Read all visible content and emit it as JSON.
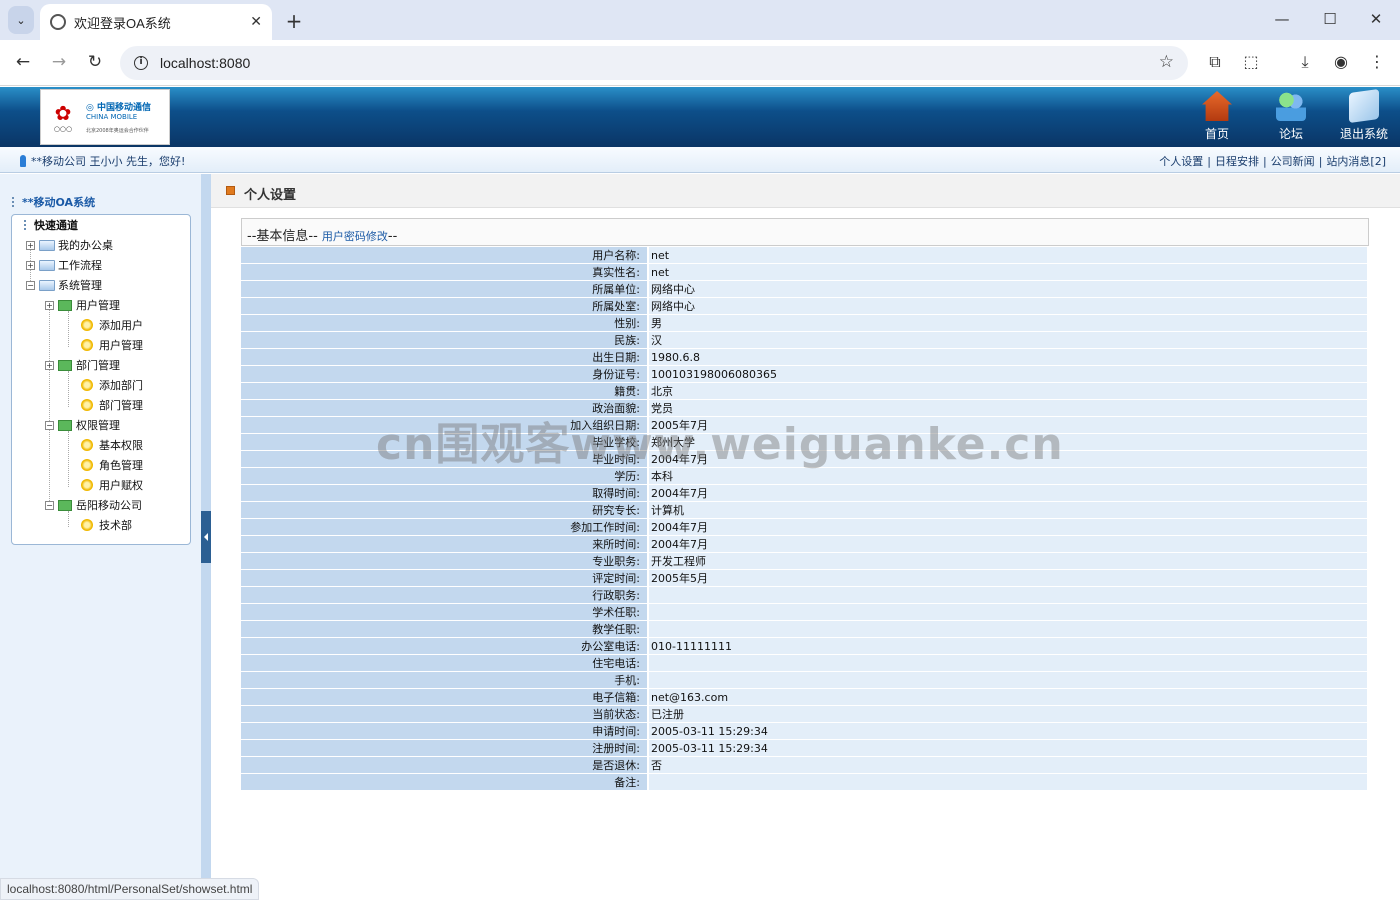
{
  "browser": {
    "tab_title": "欢迎登录OA系统",
    "tab_close": "✕",
    "new_tab": "+",
    "url": "localhost:8080",
    "status_url": "localhost:8080/html/PersonalSet/showset.html"
  },
  "header": {
    "nav": [
      {
        "label": "首页",
        "icon": "home-icon"
      },
      {
        "label": "论坛",
        "icon": "forum-icon"
      },
      {
        "label": "退出系统",
        "icon": "exit-icon"
      }
    ]
  },
  "userbar": {
    "greeting": "**移动公司 王小小 先生，您好!",
    "links": [
      "个人设置",
      "日程安排",
      "公司新闻",
      "站内消息[2]"
    ]
  },
  "sidebar": {
    "title": "**移动OA系统",
    "quick": "快速通道",
    "tree": {
      "l1": [
        "我的办公桌",
        "工作流程",
        "系统管理"
      ],
      "user_mgmt": "用户管理",
      "user_children": [
        "添加用户",
        "用户管理"
      ],
      "dept_mgmt": "部门管理",
      "dept_children": [
        "添加部门",
        "部门管理"
      ],
      "perm_mgmt": "权限管理",
      "perm_children": [
        "基本权限",
        "角色管理",
        "用户赋权"
      ],
      "company": "岳阳移动公司",
      "company_children": [
        "技术部"
      ]
    }
  },
  "main": {
    "title": "个人设置",
    "section_prefix": "--基本信息--",
    "section_link": "用户密码修改",
    "section_suffix": "--",
    "fields": [
      {
        "label": "用户名称:",
        "value": "net"
      },
      {
        "label": "真实性名:",
        "value": "net"
      },
      {
        "label": "所属单位:",
        "value": "网络中心"
      },
      {
        "label": "所属处室:",
        "value": "网络中心"
      },
      {
        "label": "性别:",
        "value": "男"
      },
      {
        "label": "民族:",
        "value": "汉"
      },
      {
        "label": "出生日期:",
        "value": "1980.6.8"
      },
      {
        "label": "身份证号:",
        "value": "100103198006080365"
      },
      {
        "label": "籍贯:",
        "value": "北京"
      },
      {
        "label": "政治面貌:",
        "value": "党员"
      },
      {
        "label": "加入组织日期:",
        "value": "2005年7月"
      },
      {
        "label": "毕业学校:",
        "value": "郑州大学"
      },
      {
        "label": "毕业时间:",
        "value": "2004年7月"
      },
      {
        "label": "学历:",
        "value": "本科"
      },
      {
        "label": "取得时间:",
        "value": "2004年7月"
      },
      {
        "label": "研究专长:",
        "value": "计算机"
      },
      {
        "label": "参加工作时间:",
        "value": "2004年7月"
      },
      {
        "label": "来所时间:",
        "value": "2004年7月"
      },
      {
        "label": "专业职务:",
        "value": "开发工程师"
      },
      {
        "label": "评定时间:",
        "value": "2005年5月"
      },
      {
        "label": "行政职务:",
        "value": ""
      },
      {
        "label": "学术任职:",
        "value": ""
      },
      {
        "label": "教学任职:",
        "value": ""
      },
      {
        "label": "办公室电话:",
        "value": "010-11111111"
      },
      {
        "label": "住宅电话:",
        "value": ""
      },
      {
        "label": "手机:",
        "value": ""
      },
      {
        "label": "电子信箱:",
        "value": "net@163.com"
      },
      {
        "label": "当前状态:",
        "value": "已注册"
      },
      {
        "label": "申请时间:",
        "value": "2005-03-11 15:29:34"
      },
      {
        "label": "注册时间:",
        "value": "2005-03-11 15:29:34"
      },
      {
        "label": "是否退休:",
        "value": "否"
      },
      {
        "label": "备注:",
        "value": ""
      }
    ]
  },
  "watermark": "cn围观客www.weiguanke.cn"
}
